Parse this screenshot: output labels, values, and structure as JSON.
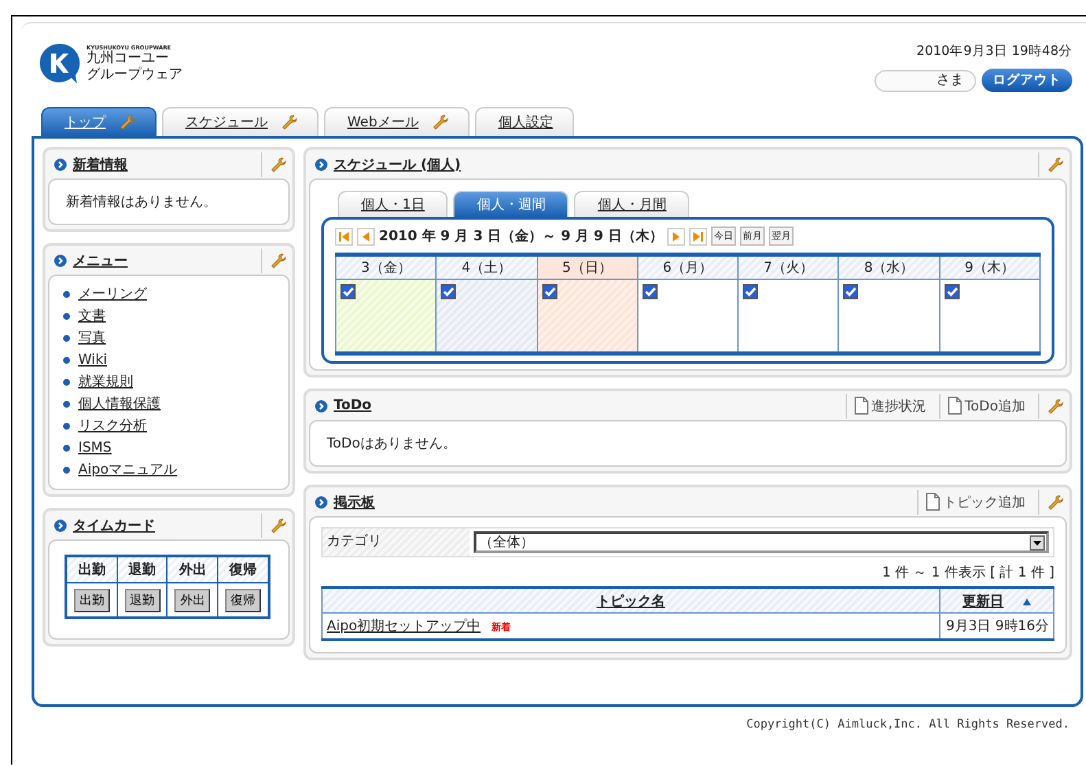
{
  "header": {
    "logo_caption": "KYUSHUKOYU GROUPWARE",
    "logo_lines": [
      "九州コーユー",
      "グループウェア"
    ],
    "datetime": "2010年9月3日 19時48分",
    "user_suffix": "さま",
    "logout": "ログアウト"
  },
  "tabs": [
    {
      "label": "トップ",
      "selected": true,
      "settings": true
    },
    {
      "label": "スケジュール",
      "selected": false,
      "settings": true
    },
    {
      "label": "Webメール",
      "selected": false,
      "settings": true
    },
    {
      "label": "個人設定",
      "selected": false,
      "settings": false
    }
  ],
  "news": {
    "title": "新着情報",
    "message": "新着情報はありません。"
  },
  "menu": {
    "title": "メニュー",
    "items": [
      "メーリング",
      "文書",
      "写真",
      "Wiki",
      "就業規則",
      "個人情報保護",
      "リスク分析",
      "ISMS",
      "Aipoマニュアル"
    ]
  },
  "timecard": {
    "title": "タイムカード",
    "columns": [
      "出勤",
      "退勤",
      "外出",
      "復帰"
    ],
    "buttons": [
      "出勤",
      "退勤",
      "外出",
      "復帰"
    ]
  },
  "schedule": {
    "title": "スケジュール (個人)",
    "view_tabs": [
      {
        "label": "個人・1日",
        "selected": false
      },
      {
        "label": "個人・週間",
        "selected": true
      },
      {
        "label": "個人・月間",
        "selected": false
      }
    ],
    "range": "2010 年 9 月 3 日（金）～ 9 月 9 日（木）",
    "jump_buttons": [
      "今日",
      "前月",
      "翌月"
    ],
    "days": [
      {
        "label": "3（金）",
        "kind": "today",
        "checked": true
      },
      {
        "label": "4（土）",
        "kind": "saturday",
        "checked": true
      },
      {
        "label": "5（日）",
        "kind": "sunday",
        "checked": true
      },
      {
        "label": "6（月）",
        "kind": "weekday",
        "checked": true
      },
      {
        "label": "7（火）",
        "kind": "weekday",
        "checked": true
      },
      {
        "label": "8（水）",
        "kind": "weekday",
        "checked": true
      },
      {
        "label": "9（木）",
        "kind": "weekday",
        "checked": true
      }
    ]
  },
  "todo": {
    "title": "ToDo",
    "actions": [
      "進捗状況",
      "ToDo追加"
    ],
    "message": "ToDoはありません。"
  },
  "board": {
    "title": "掲示板",
    "actions": [
      "トピック追加"
    ],
    "category_label": "カテゴリ",
    "category_value": "（全体）",
    "count": "1 件 ～ 1 件表示 [ 計 1 件 ]",
    "columns": [
      "トピック名",
      "更新日"
    ],
    "rows": [
      {
        "topic": "Aipo初期セットアップ中",
        "badge": "新着",
        "updated": "9月3日 9時16分"
      }
    ]
  },
  "footer": {
    "copyright": "Copyright(C) Aimluck,Inc. All Rights Reserved."
  }
}
